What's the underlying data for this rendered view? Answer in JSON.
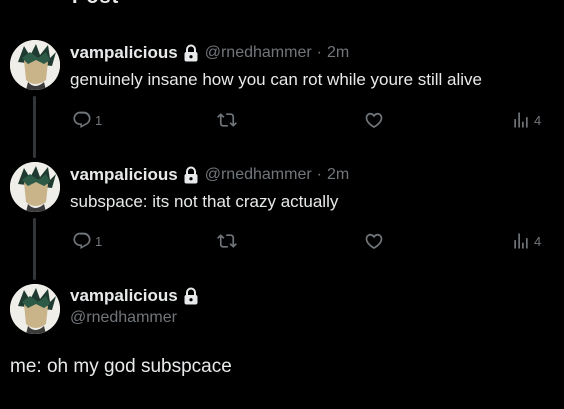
{
  "top_cut_text": "Post",
  "tweets": [
    {
      "name": "vampalicious",
      "handle": "@rnedhammer",
      "separator": "·",
      "time": "2m",
      "text": "genuinely insane how you can rot while youre still alive",
      "replies": "1",
      "views": "4"
    },
    {
      "name": "vampalicious",
      "handle": "@rnedhammer",
      "separator": "·",
      "time": "2m",
      "text": "subspace: its not that crazy actually",
      "replies": "1",
      "views": "4"
    }
  ],
  "main_tweet": {
    "name": "vampalicious",
    "handle": "@rnedhammer",
    "text": "me: oh my god subspcace"
  },
  "bottom_cut_text": "",
  "colors": {
    "background": "#000000",
    "text": "#e7e9ea",
    "muted": "#71767b",
    "thread_line": "#333639"
  },
  "icons": [
    "lock-icon",
    "reply-icon",
    "retweet-icon",
    "like-icon",
    "views-icon"
  ]
}
